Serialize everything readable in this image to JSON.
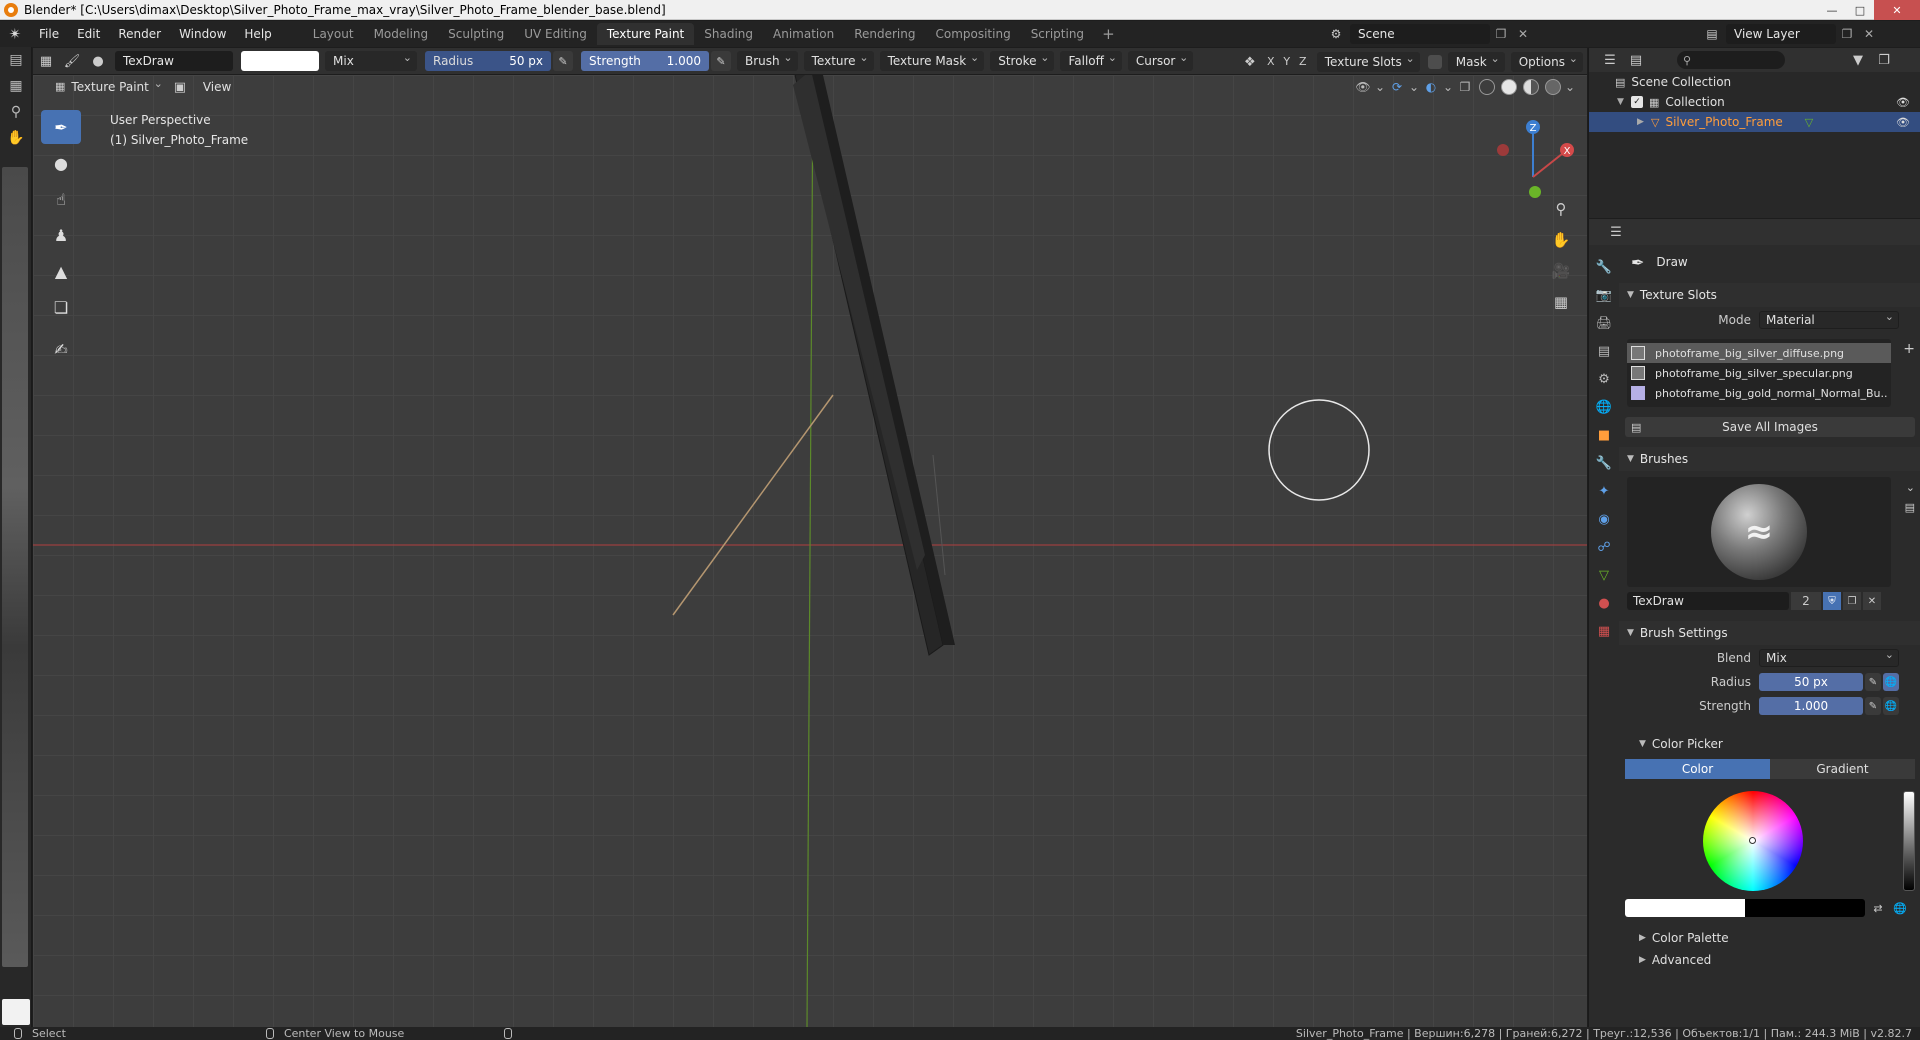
{
  "window": {
    "title": "Blender* [C:\\Users\\dimax\\Desktop\\Silver_Photo_Frame_max_vray\\Silver_Photo_Frame_blender_base.blend]"
  },
  "menu": {
    "items": [
      "File",
      "Edit",
      "Render",
      "Window",
      "Help"
    ]
  },
  "workspaces": {
    "tabs": [
      "Layout",
      "Modeling",
      "Sculpting",
      "UV Editing",
      "Texture Paint",
      "Shading",
      "Animation",
      "Rendering",
      "Compositing",
      "Scripting"
    ],
    "active": "Texture Paint"
  },
  "scene": {
    "name": "Scene"
  },
  "view_layer": {
    "name": "View Layer"
  },
  "header": {
    "brush_name": "TexDraw",
    "blend_mode": "Mix",
    "radius_label": "Radius",
    "radius_value": "50 px",
    "strength_label": "Strength",
    "strength_value": "1.000",
    "dropdowns": [
      "Brush",
      "Texture",
      "Texture Mask",
      "Stroke",
      "Falloff",
      "Cursor"
    ],
    "axes": [
      "X",
      "Y",
      "Z"
    ],
    "texture_slots": "Texture Slots",
    "mask": "Mask",
    "options": "Options"
  },
  "row2": {
    "mode": "Texture Paint",
    "view": "View"
  },
  "viewport": {
    "perspective": "User Perspective",
    "object": "(1) Silver_Photo_Frame",
    "axis_x_color": "#c84848",
    "axis_y_color": "#7bb63b"
  },
  "gizmo": {
    "z": "Z",
    "x": "X"
  },
  "outliner": {
    "scene_collection": "Scene Collection",
    "collection": "Collection",
    "object": "Silver_Photo_Frame"
  },
  "properties": {
    "tool": "Draw",
    "texture_slots": {
      "title": "Texture Slots",
      "mode_label": "Mode",
      "mode_value": "Material",
      "slots": [
        "photoframe_big_silver_diffuse.png",
        "photoframe_big_silver_specular.png",
        "photoframe_big_gold_normal_Normal_Bu.."
      ],
      "save_all": "Save All Images"
    },
    "brushes": {
      "title": "Brushes",
      "name": "TexDraw",
      "users": "2"
    },
    "brush_settings": {
      "title": "Brush Settings",
      "blend_label": "Blend",
      "blend_value": "Mix",
      "radius_label": "Radius",
      "radius_value": "50 px",
      "strength_label": "Strength",
      "strength_value": "1.000"
    },
    "color_picker": {
      "title": "Color Picker",
      "tab_color": "Color",
      "tab_gradient": "Gradient"
    },
    "color_palette": "Color Palette",
    "advanced": "Advanced"
  },
  "statusbar": {
    "select": "Select",
    "center_view": "Center View to Mouse",
    "stats": "Silver_Photo_Frame | Вершин:6,278 | Граней:6,272 | Треуг.:12,536 | Объектов:1/1 | Пам.: 244.3 MiB | v2.82.7"
  }
}
